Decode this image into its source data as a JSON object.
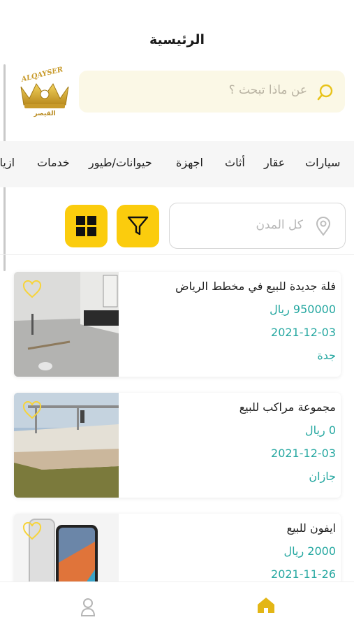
{
  "header": {
    "title": "الرئيسية"
  },
  "logo": {
    "text_en": "ALQAYSER",
    "text_ar": "القيصر"
  },
  "search": {
    "placeholder": "عن ماذا تبحث ؟",
    "icon": "search-icon"
  },
  "categories": [
    "سيارات",
    "عقار",
    "أثاث",
    "اجهزة",
    "حيوانات/طيور",
    "خدمات",
    "ازياء"
  ],
  "filters": {
    "city_placeholder": "كل المدن",
    "city_icon": "location-pin-icon",
    "filter_icon": "filter-icon",
    "view_icon": "grid-view-icon"
  },
  "listings": [
    {
      "title": "فلة جديدة للبيع في  مخطط الرياض",
      "price": "950000 ريال",
      "date": "2021-12-03",
      "city": "جدة"
    },
    {
      "title": "مجموعة مراكب للبيع",
      "price": "0 ريال",
      "date": "2021-12-03",
      "city": "جازان"
    },
    {
      "title": "ايفون للبيع",
      "price": "2000 ريال",
      "date": "2021-11-26",
      "city": ""
    }
  ],
  "bottom_nav": {
    "home_icon": "home-icon",
    "profile_icon": "profile-icon"
  },
  "colors": {
    "accent": "#fbcc0d",
    "teal": "#24a7a0",
    "search_bg": "#fbf8e6"
  }
}
